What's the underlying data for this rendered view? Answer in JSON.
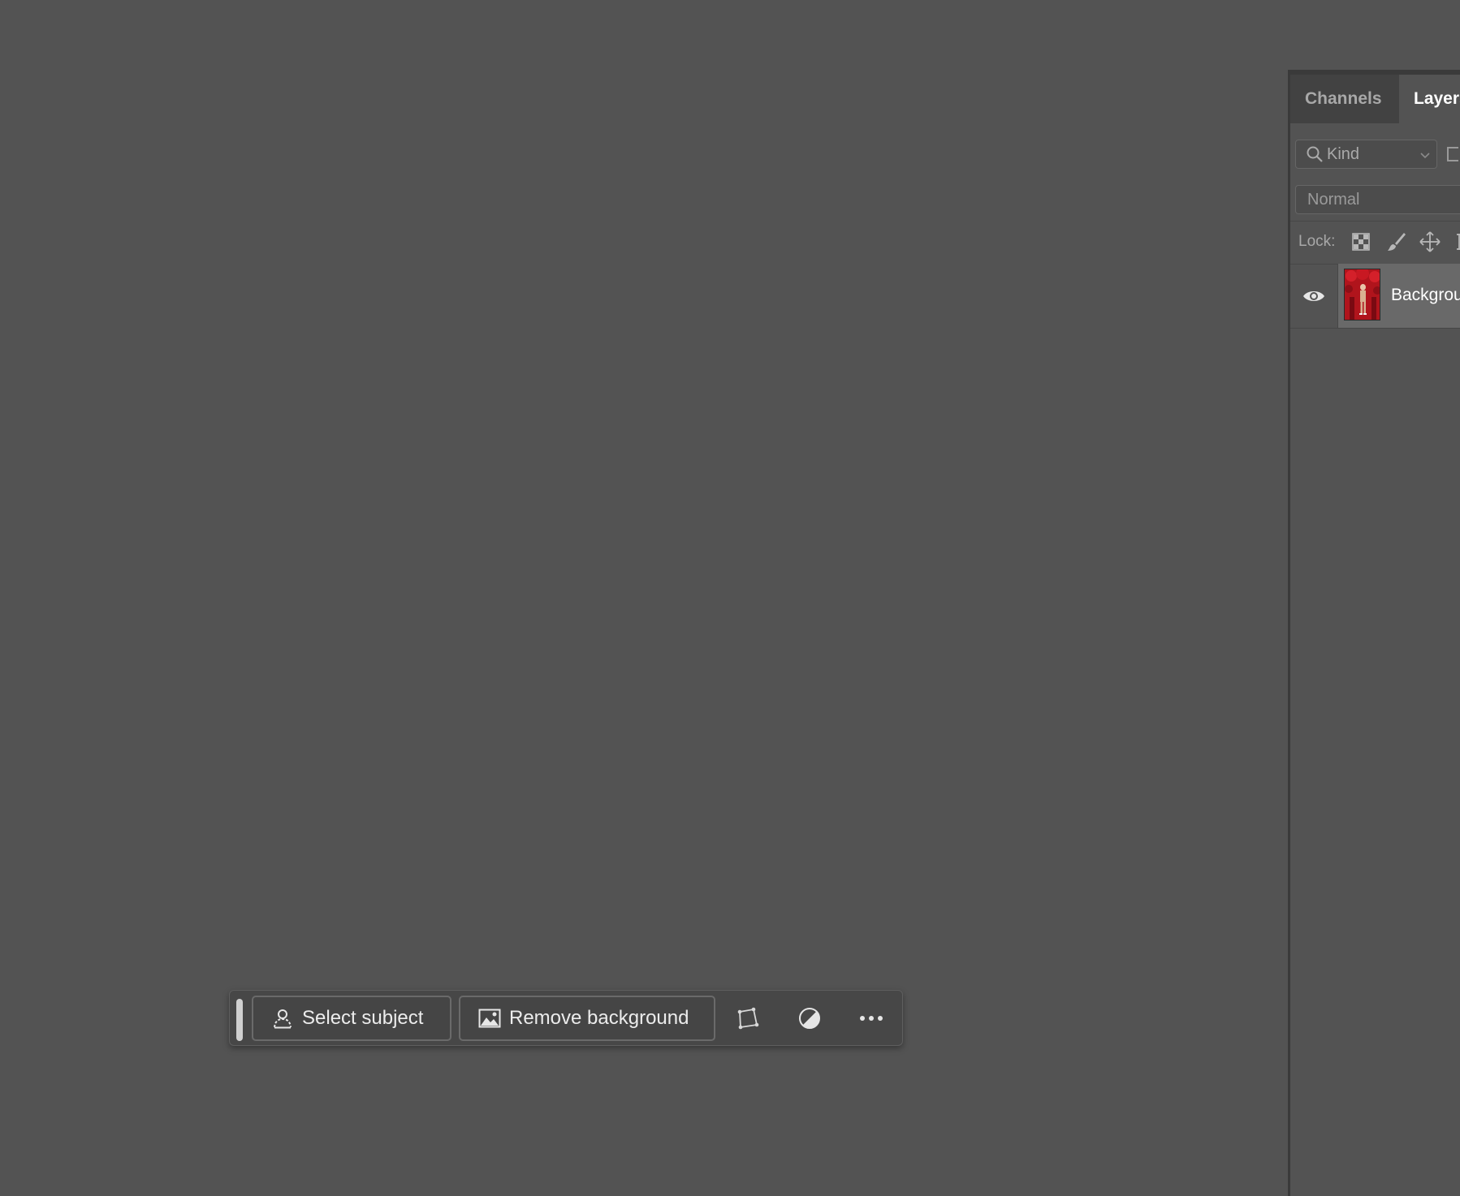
{
  "taskbar": {
    "select_subject_label": "Select subject",
    "remove_background_label": "Remove background",
    "icons": [
      "person-select-icon",
      "image-icon",
      "transform-icon",
      "adjustment-icon",
      "more-options-icon"
    ]
  },
  "panel": {
    "tabs": [
      {
        "label": "Channels",
        "active": false
      },
      {
        "label": "Layers",
        "active": true
      }
    ],
    "filter": {
      "kind_label": "Kind"
    },
    "blend_mode": "Normal",
    "lock_label": "Lock:",
    "layers": [
      {
        "name": "Background",
        "visible": true,
        "selected": true
      }
    ]
  },
  "colors": {
    "canvas_bg": "#535353",
    "panel_tab_bg": "#424242",
    "selected_layer": "#696969",
    "thumbnail_red": "#b0141c"
  }
}
